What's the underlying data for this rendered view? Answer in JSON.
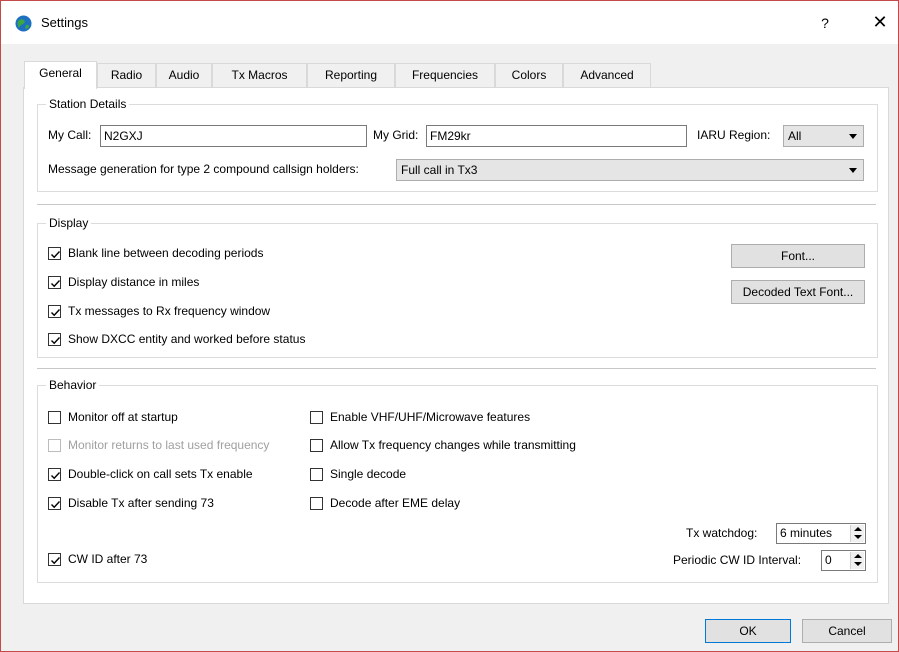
{
  "window": {
    "title": "Settings",
    "help_glyph": "?",
    "close_glyph": "✕"
  },
  "tabs": [
    {
      "label": "General",
      "active": true
    },
    {
      "label": "Radio"
    },
    {
      "label": "Audio"
    },
    {
      "label": "Tx Macros"
    },
    {
      "label": "Reporting"
    },
    {
      "label": "Frequencies"
    },
    {
      "label": "Colors"
    },
    {
      "label": "Advanced"
    }
  ],
  "station": {
    "group_title": "Station Details",
    "my_call_label": "My Call:",
    "my_call_value": "N2GXJ",
    "my_grid_label": "My Grid:",
    "my_grid_value": "FM29kr",
    "iaru_label": "IARU Region:",
    "iaru_value": "All",
    "msg_gen_label": "Message generation for type 2 compound callsign holders:",
    "msg_gen_value": "Full call in Tx3"
  },
  "display": {
    "group_title": "Display",
    "checkboxes": [
      {
        "label": "Blank line between decoding periods",
        "checked": true
      },
      {
        "label": "Display distance in miles",
        "checked": true
      },
      {
        "label": "Tx messages to Rx frequency window",
        "checked": true
      },
      {
        "label": "Show DXCC entity and worked before status",
        "checked": true
      }
    ],
    "font_button": "Font...",
    "decoded_font_button": "Decoded Text Font..."
  },
  "behavior": {
    "group_title": "Behavior",
    "left_checkboxes": [
      {
        "label": "Monitor off at startup",
        "checked": false,
        "disabled": false
      },
      {
        "label": "Monitor returns to last used frequency",
        "checked": false,
        "disabled": true
      },
      {
        "label": "Double-click on call sets Tx enable",
        "checked": true,
        "disabled": false
      },
      {
        "label": "Disable Tx after sending 73",
        "checked": true,
        "disabled": false
      }
    ],
    "right_checkboxes": [
      {
        "label": "Enable VHF/UHF/Microwave features",
        "checked": false
      },
      {
        "label": "Allow Tx frequency changes while transmitting",
        "checked": false
      },
      {
        "label": "Single decode",
        "checked": false
      },
      {
        "label": "Decode after EME delay",
        "checked": false
      }
    ],
    "cwid_label": "CW ID after 73",
    "cwid_checked": true,
    "watchdog_label": "Tx watchdog:",
    "watchdog_value": "6 minutes",
    "periodic_label": "Periodic CW ID Interval:",
    "periodic_value": "0"
  },
  "footer": {
    "ok_label": "OK",
    "cancel_label": "Cancel"
  },
  "colors": {
    "accent": "#0078d7",
    "window_border": "#c44a4a"
  }
}
